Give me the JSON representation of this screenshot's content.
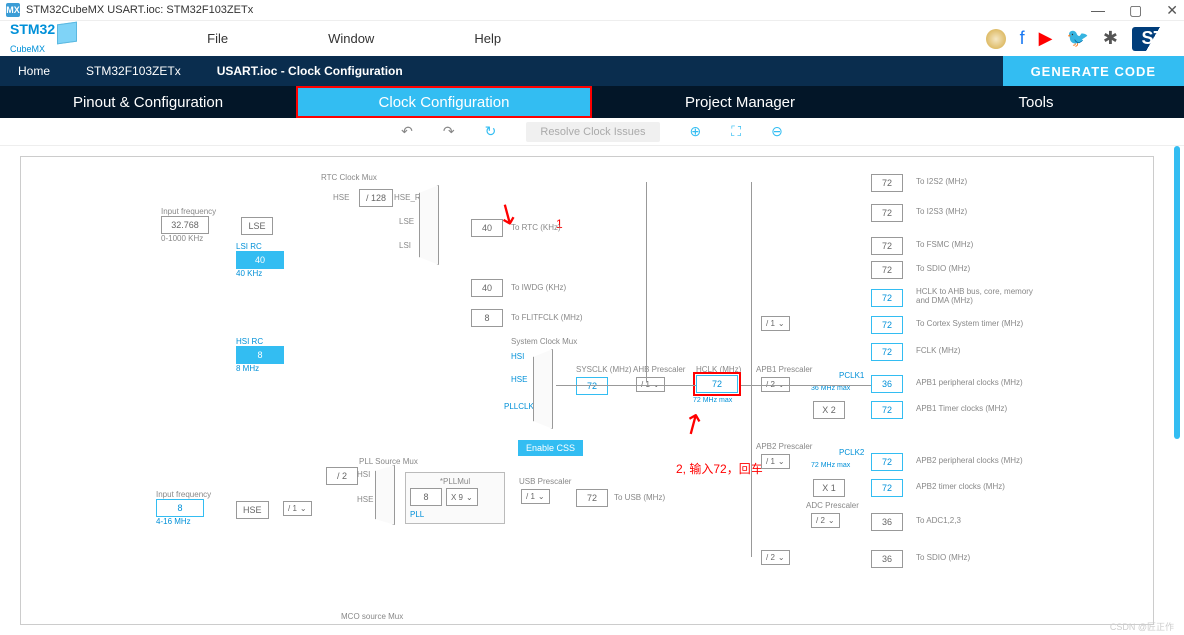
{
  "window": {
    "title": "STM32CubeMX USART.ioc: STM32F103ZETx"
  },
  "logo": {
    "line1": "STM32",
    "line2": "CubeMX"
  },
  "menu": {
    "file": "File",
    "window": "Window",
    "help": "Help"
  },
  "breadcrumb": {
    "home": "Home",
    "chip": "STM32F103ZETx",
    "page": "USART.ioc - Clock Configuration",
    "generate": "GENERATE CODE"
  },
  "tabs": {
    "pinout": "Pinout & Configuration",
    "clock": "Clock Configuration",
    "project": "Project Manager",
    "tools": "Tools"
  },
  "toolbar": {
    "resolve": "Resolve Clock Issues"
  },
  "annotations": {
    "a1": "1",
    "a2": "2, 输入72，回车"
  },
  "clk": {
    "input_freq_lbl": "Input frequency",
    "lse_val": "32.768",
    "lse_range": "0-1000 KHz",
    "lse": "LSE",
    "lsirc_lbl": "LSI RC",
    "lsirc_val": "40",
    "lsirc_note": "40 KHz",
    "hsirc_lbl": "HSI RC",
    "hsirc_val": "8",
    "hsirc_note": "8 MHz",
    "hse_lbl": "HSE",
    "hse_input_lbl": "Input frequency",
    "hse_val": "8",
    "hse_range": "4-16 MHz",
    "div128": "/ 128",
    "hse_rtc": "HSE_RTC",
    "rtc_mux": "RTC Clock Mux",
    "to_rtc": "To RTC (KHz)",
    "to_rtc_val": "40",
    "to_iwdg": "To IWDG (KHz)",
    "to_iwdg_val": "40",
    "flitf": "To FLITFCLK (MHz)",
    "flitf_val": "8",
    "sys_mux": "System Clock Mux",
    "hsi": "HSI",
    "hse": "HSE",
    "pllclk": "PLLCLK",
    "lsi": "LSI",
    "css": "Enable CSS",
    "sysclk_lbl": "SYSCLK (MHz)",
    "sysclk_val": "72",
    "ahb_lbl": "AHB Prescaler",
    "ahb_div": "/ 1",
    "hclk_lbl": "HCLK (MHz)",
    "hclk_val": "72",
    "hclk_max": "72 MHz max",
    "apb1_lbl": "APB1 Prescaler",
    "apb1_div": "/ 2",
    "apb1_note": "36 MHz max",
    "pclk1": "PCLK1",
    "apb1_x": "X 2",
    "apb2_lbl": "APB2 Prescaler",
    "apb2_div": "/ 1",
    "apb2_note": "72 MHz max",
    "pclk2": "PCLK2",
    "apb2_x": "X 1",
    "adc_lbl": "ADC Prescaler",
    "adc_div": "/ 2",
    "sdio_div": "/ 2",
    "pll_src": "PLL Source Mux",
    "pll_div": "/ 2",
    "pllmul_lbl": "*PLLMul",
    "pllmul": "X 9",
    "pll_in": "8",
    "pll": "PLL",
    "usb_pre": "USB Prescaler",
    "usb_div": "/ 1",
    "usb_val": "72",
    "usb_lbl": "To USB (MHz)",
    "hse_div": "/ 1",
    "cortex_div": "/ 1",
    "mco": "MCO source Mux",
    "outs": {
      "i2s2": {
        "v": "72",
        "l": "To I2S2 (MHz)"
      },
      "i2s3": {
        "v": "72",
        "l": "To I2S3 (MHz)"
      },
      "fsmc": {
        "v": "72",
        "l": "To FSMC (MHz)"
      },
      "sdio1": {
        "v": "72",
        "l": "To SDIO (MHz)"
      },
      "ahb": {
        "v": "72",
        "l": "HCLK to AHB bus, core, memory and DMA (MHz)"
      },
      "cortex": {
        "v": "72",
        "l": "To Cortex System timer (MHz)"
      },
      "fclk": {
        "v": "72",
        "l": "FCLK (MHz)"
      },
      "apb1p": {
        "v": "36",
        "l": "APB1 peripheral clocks (MHz)"
      },
      "apb1t": {
        "v": "72",
        "l": "APB1 Timer clocks (MHz)"
      },
      "apb2p": {
        "v": "72",
        "l": "APB2 peripheral clocks (MHz)"
      },
      "apb2t": {
        "v": "72",
        "l": "APB2 timer clocks (MHz)"
      },
      "adc": {
        "v": "36",
        "l": "To ADC1,2,3"
      },
      "sdio2": {
        "v": "36",
        "l": "To SDIO (MHz)"
      }
    }
  },
  "watermark": "CSDN @匠正作"
}
